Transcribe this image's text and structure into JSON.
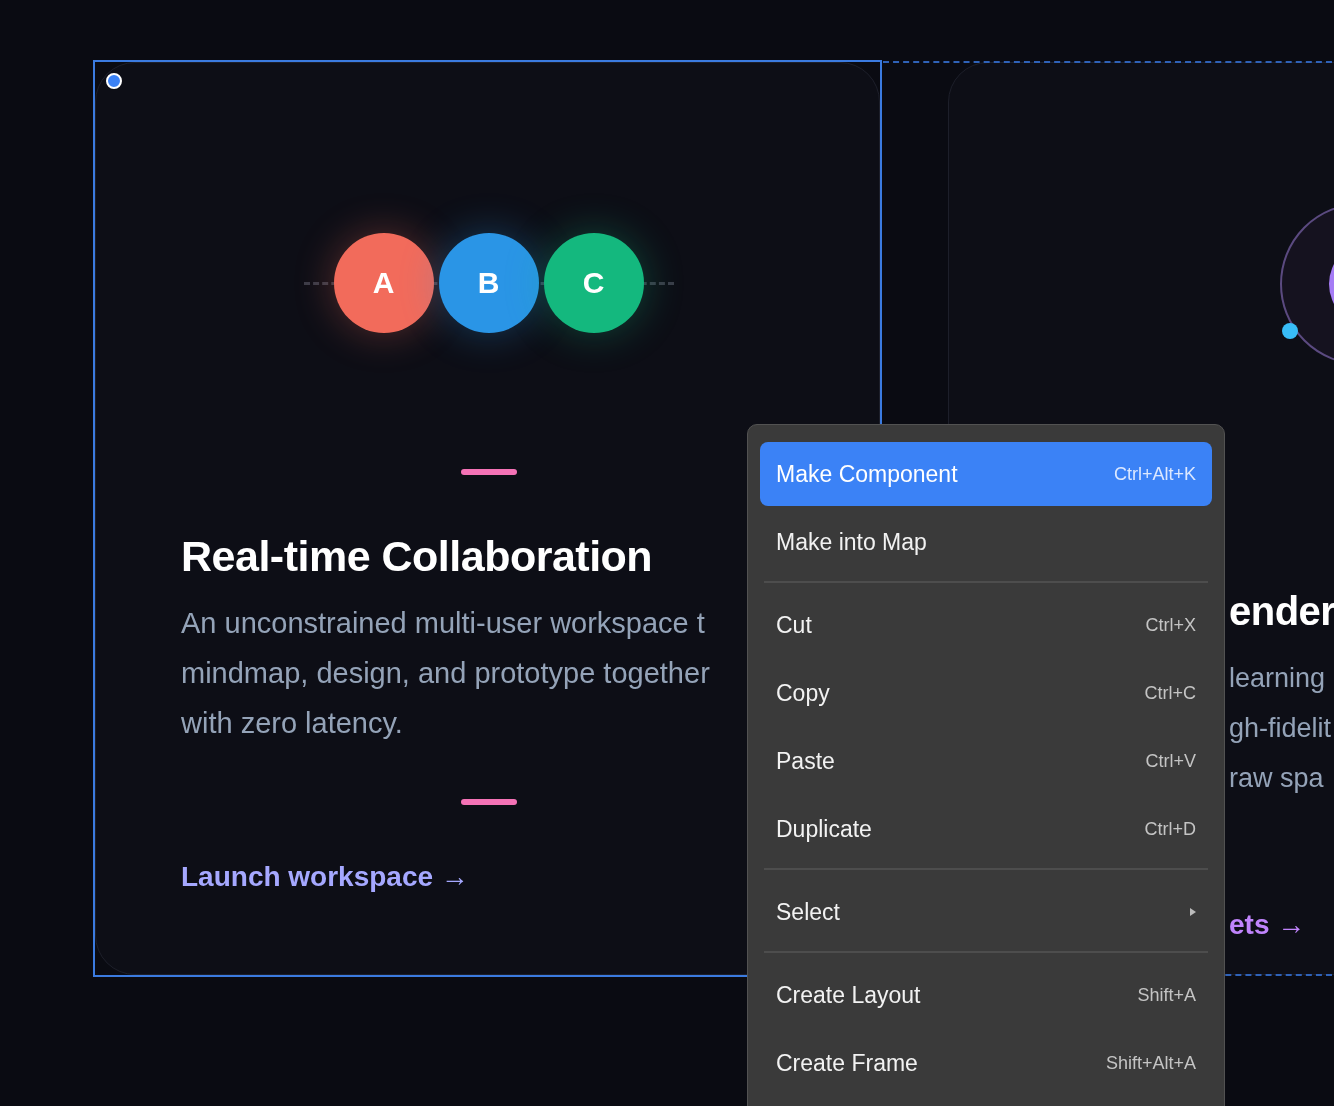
{
  "cards": [
    {
      "kind": "avatars",
      "avatars": [
        {
          "letter": "A",
          "color": "#f26b5b"
        },
        {
          "letter": "B",
          "color": "#2a95e6"
        },
        {
          "letter": "C",
          "color": "#14b87e"
        }
      ],
      "title": "Real-time Collaboration",
      "lines": [
        "An unconstrained multi-user workspace t",
        "mindmap, design, and prototype together",
        "with zero latency."
      ],
      "link": "Launch workspace →",
      "selected": true
    },
    {
      "kind": "orbit",
      "title": "ender",
      "lines": [
        "learning",
        "gh-fidelit",
        "raw spa"
      ],
      "link": "ets →",
      "selected": false
    }
  ],
  "context_menu": {
    "items": [
      {
        "kind": "item",
        "label": "Make Component",
        "shortcut": "Ctrl+Alt+K",
        "selected": true
      },
      {
        "kind": "item",
        "label": "Make into Map",
        "selected": false
      },
      {
        "kind": "separator"
      },
      {
        "kind": "item",
        "label": "Cut",
        "shortcut": "Ctrl+X",
        "selected": false
      },
      {
        "kind": "item",
        "label": "Copy",
        "shortcut": "Ctrl+C",
        "selected": false
      },
      {
        "kind": "item",
        "label": "Paste",
        "shortcut": "Ctrl+V",
        "selected": false
      },
      {
        "kind": "item",
        "label": "Duplicate",
        "shortcut": "Ctrl+D",
        "selected": false
      },
      {
        "kind": "separator"
      },
      {
        "kind": "submenu",
        "label": "Select",
        "selected": false
      },
      {
        "kind": "separator"
      },
      {
        "kind": "item",
        "label": "Create Layout",
        "shortcut": "Shift+A",
        "selected": false
      },
      {
        "kind": "item",
        "label": "Create Frame",
        "shortcut": "Shift+Alt+A",
        "selected": false
      }
    ]
  }
}
